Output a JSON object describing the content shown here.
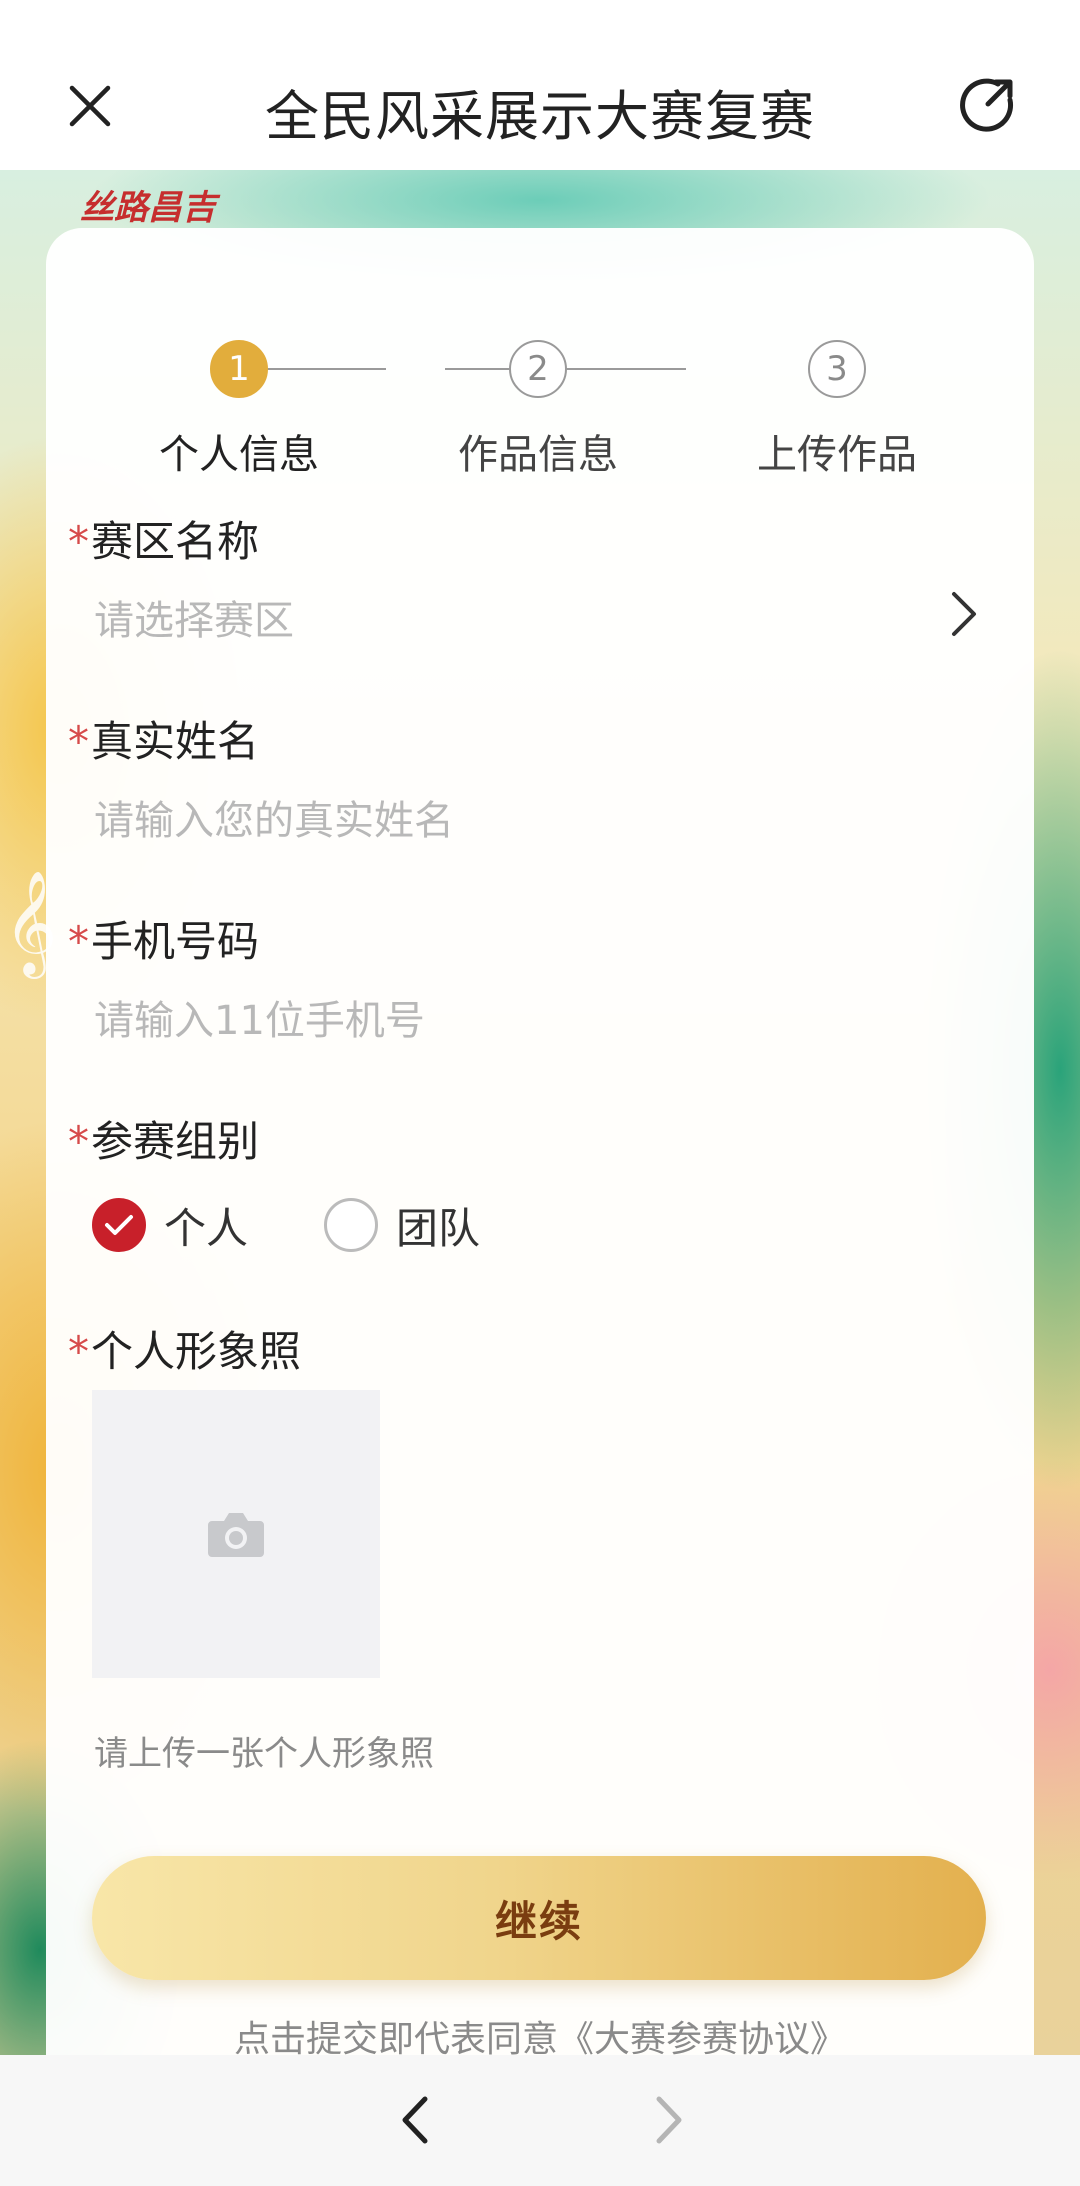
{
  "header": {
    "title": "全民风采展示大赛复赛",
    "close_icon": "close-icon",
    "share_icon": "share-icon"
  },
  "background": {
    "brand_text": "丝路昌吉",
    "music_note": "𝄞"
  },
  "stepper": {
    "steps": [
      {
        "number": "1",
        "label": "个人信息",
        "active": true
      },
      {
        "number": "2",
        "label": "作品信息",
        "active": false
      },
      {
        "number": "3",
        "label": "上传作品",
        "active": false
      }
    ],
    "accent_color": "#e2ad3c"
  },
  "form": {
    "region": {
      "label": "赛区名称",
      "placeholder": "请选择赛区"
    },
    "name": {
      "label": "真实姓名",
      "placeholder": "请输入您的真实姓名"
    },
    "phone": {
      "label": "手机号码",
      "placeholder": "请输入11位手机号"
    },
    "group": {
      "label": "参赛组别",
      "options": [
        {
          "text": "个人",
          "checked": true
        },
        {
          "text": "团队",
          "checked": false
        }
      ]
    },
    "photo": {
      "label": "个人形象照",
      "hint": "请上传一张个人形象照"
    },
    "required_mark": "*"
  },
  "actions": {
    "continue_label": "继续",
    "agreement_text": "点击提交即代表同意《大赛参赛协议》"
  },
  "colors": {
    "required": "#d64a4a",
    "radio_checked": "#c8202a",
    "button_text": "#7a3d10"
  }
}
